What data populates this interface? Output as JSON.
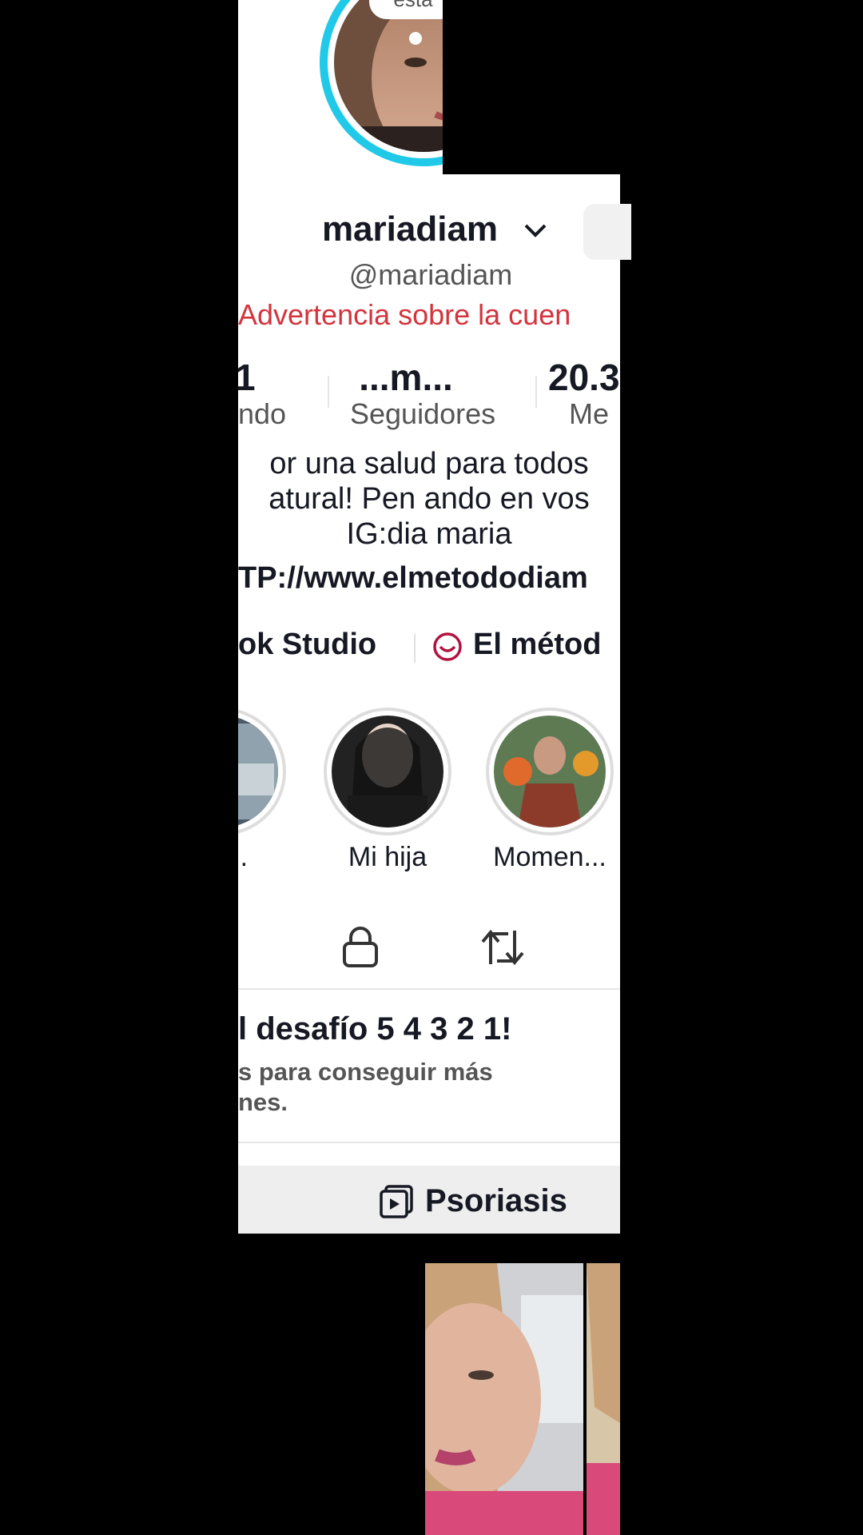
{
  "colors": {
    "warning": "#d3343d",
    "text": "#161823",
    "secondary": "#555555",
    "ring": "#20c9e8",
    "tab_bg": "#eeeeee",
    "divider": "#e6e6e6",
    "brand_icon": "#b3123f"
  },
  "avatar": {
    "bubble_text": "esta",
    "icon": "avatar-photo"
  },
  "profile": {
    "display_name": "mariadiam",
    "handle": "@mariadiam",
    "warning": "Advertencia sobre la cuen",
    "dropdown_icon": "chevron-down-icon"
  },
  "stats": {
    "following_value": "1",
    "following_label": "ndo",
    "followers_value": "...m...",
    "followers_label": "Seguidores",
    "likes_value": "20.3",
    "likes_label": "Me"
  },
  "bio": {
    "line1": "or una salud  para todos",
    "line2": "atural! Pen ando en vos",
    "line3": "IG:dia  maria",
    "link": "TP://www.elmetododiam"
  },
  "links": {
    "studio": "ok Studio",
    "method": "El métod",
    "method_icon": "chat-bubble-smile-icon"
  },
  "highlights": [
    {
      "label": "os..."
    },
    {
      "label": "Mi hija"
    },
    {
      "label": "Momen..."
    }
  ],
  "tabs": {
    "lock_icon": "lock-icon",
    "repost_icon": "repost-icon"
  },
  "challenge": {
    "title": "l desafío 5 4 3 2 1!",
    "line1": "s para conseguir más",
    "line2": "nes."
  },
  "playlist": {
    "label": "Psoriasis",
    "icon": "playlist-icon"
  }
}
